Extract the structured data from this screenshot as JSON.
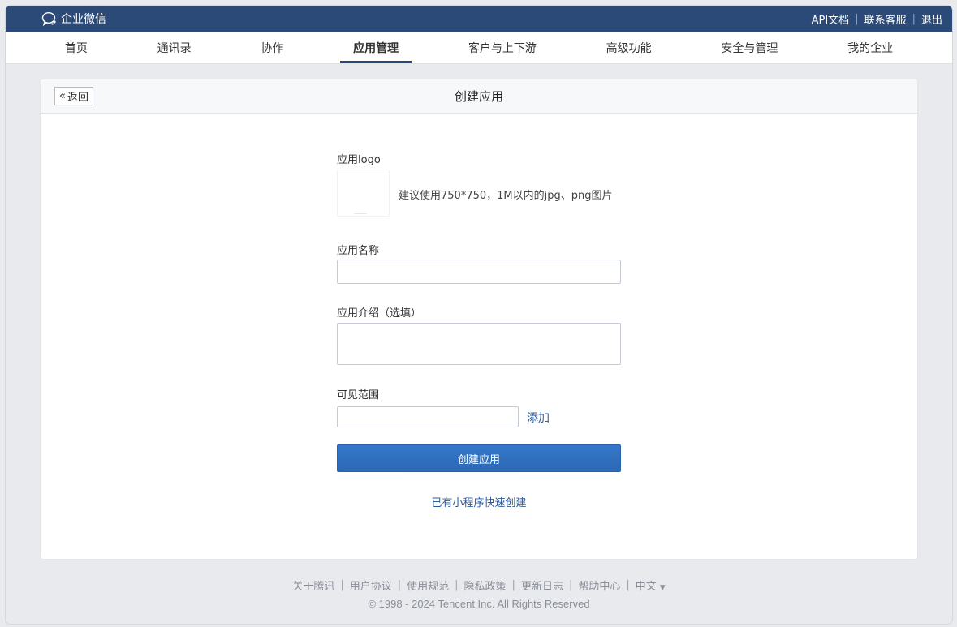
{
  "brand": {
    "name": "企业微信"
  },
  "top_links": [
    "API文档",
    "联系客服",
    "退出"
  ],
  "nav": {
    "items": [
      "首页",
      "通讯录",
      "协作",
      "应用管理",
      "客户与上下游",
      "高级功能",
      "安全与管理",
      "我的企业"
    ],
    "active": "应用管理"
  },
  "panel": {
    "back_label": "返回",
    "title": "创建应用"
  },
  "form": {
    "logo_label": "应用logo",
    "logo_hint": "建议使用750*750，1M以内的jpg、png图片",
    "name_label": "应用名称",
    "name_value": "",
    "intro_label": "应用介绍（选填）",
    "intro_value": "",
    "scope_label": "可见范围",
    "scope_value": "",
    "add_label": "添加",
    "submit_label": "创建应用",
    "mini_program_link": "已有小程序快速创建"
  },
  "footer": {
    "links": [
      "关于腾讯",
      "用户协议",
      "使用规范",
      "隐私政策",
      "更新日志",
      "帮助中心",
      "中文"
    ],
    "copyright": "© 1998 - 2024 Tencent Inc. All Rights Reserved"
  },
  "colors": {
    "topbar": "#2c4a77",
    "primary": "#2f6fc0",
    "link": "#2b5aa0"
  }
}
